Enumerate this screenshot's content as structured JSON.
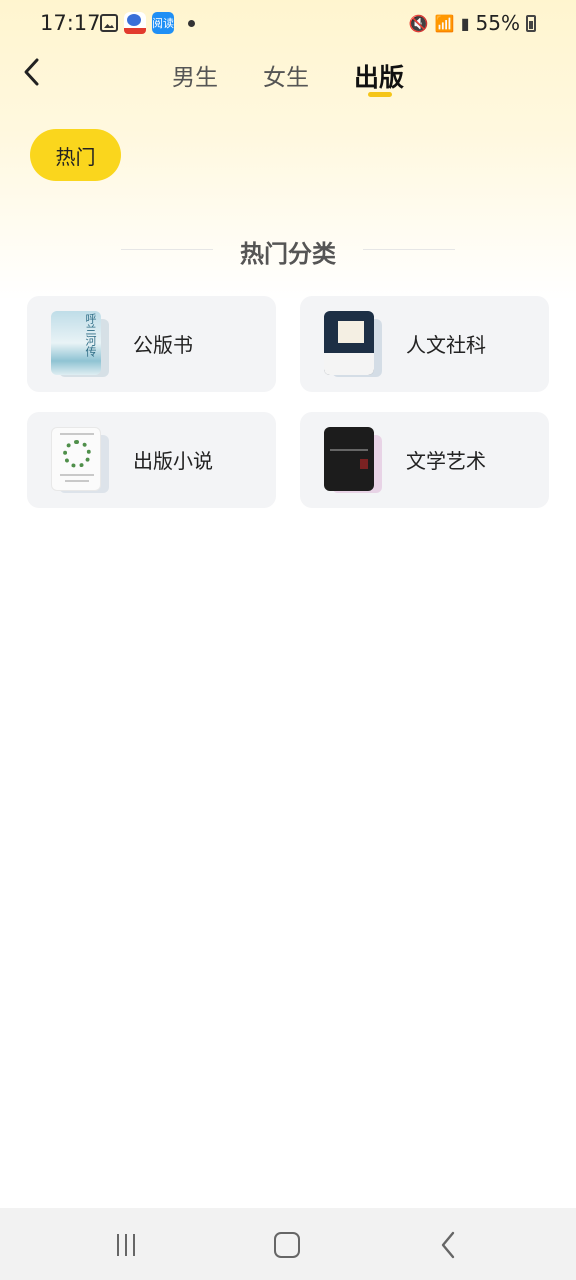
{
  "status_bar": {
    "time": "17:17",
    "app2_label": "阅读",
    "battery": "55%"
  },
  "tabs": [
    {
      "label": "男生",
      "active": false
    },
    {
      "label": "女生",
      "active": false
    },
    {
      "label": "出版",
      "active": true
    }
  ],
  "filter_chip": {
    "label": "热门",
    "selected": true
  },
  "section": {
    "title": "热门分类"
  },
  "categories": [
    {
      "label": "公版书",
      "cover_title": "呼兰河传",
      "cover_color": "#8fc3d3"
    },
    {
      "label": "人文社科",
      "cover_color": "#1d2f45"
    },
    {
      "label": "出版小说",
      "cover_color": "#fbfbfb"
    },
    {
      "label": "文学艺术",
      "cover_color": "#1c1c1c"
    }
  ],
  "colors": {
    "accent": "#fad61d",
    "card_bg": "#f3f4f6"
  },
  "nav": {
    "recent": "recent-apps-icon",
    "home": "home-icon",
    "back": "back-icon"
  }
}
